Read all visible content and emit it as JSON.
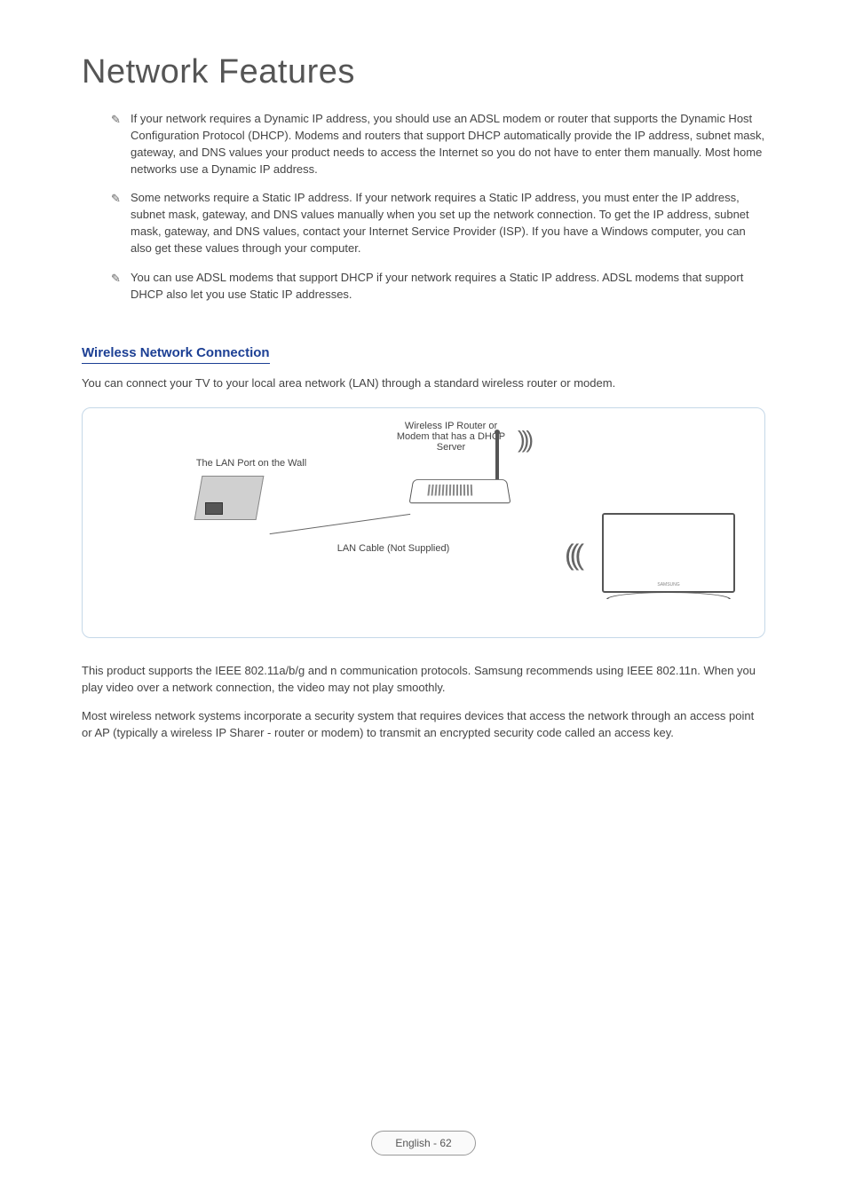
{
  "title": "Network Features",
  "notes": [
    "If your network requires a Dynamic IP address, you should use an ADSL modem or router that supports the Dynamic Host Configuration Protocol (DHCP). Modems and routers that support DHCP automatically provide the IP address, subnet mask, gateway, and DNS values your product needs to access the Internet so you do not have to enter them manually. Most home networks use a Dynamic IP address.",
    "Some networks require a Static IP address. If your network requires a Static IP address, you must enter the IP address, subnet mask, gateway, and DNS values manually when you set up the network connection. To get the IP address, subnet mask, gateway, and DNS values, contact your Internet Service Provider (ISP). If you have a Windows computer, you can also get these values through your computer.",
    "You can use ADSL modems that support DHCP if your network requires a Static IP address. ADSL modems that support DHCP also let you use Static IP addresses."
  ],
  "section": {
    "title": "Wireless Network Connection",
    "intro": "You can connect your TV to your local area network (LAN) through a standard wireless router or modem.",
    "diagram": {
      "lan_port_label": "The LAN Port on the Wall",
      "router_label": "Wireless IP Router or Modem that has a DHCP Server",
      "cable_label": "LAN Cable (Not Supplied)",
      "tv_logo": "SAMSUNG"
    },
    "paragraphs": [
      "This product supports the IEEE 802.11a/b/g and n communication protocols. Samsung recommends using IEEE 802.11n. When you play video over a network connection, the video may not play smoothly.",
      "Most wireless network systems incorporate a security system that requires devices that access the network through an access point or AP (typically a wireless IP Sharer - router or modem) to transmit an encrypted security code called an access key."
    ]
  },
  "footer": "English - 62"
}
